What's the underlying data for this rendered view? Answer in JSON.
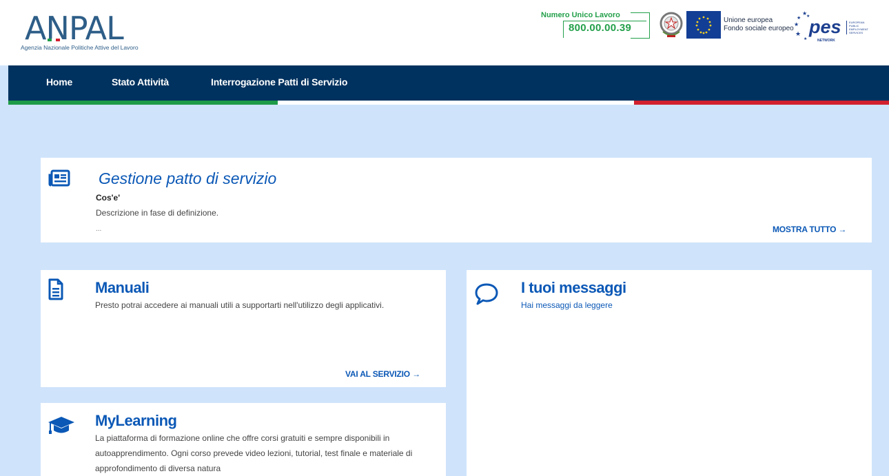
{
  "header": {
    "logo": {
      "name": "ANPAL",
      "subtitle": "Agenzia Nazionale Politiche Attive del Lavoro",
      "colors": {
        "primary": "#2e5e88",
        "flag": [
          "#1e9b48",
          "#ffffff",
          "#d2202f"
        ]
      }
    },
    "numero_unico": {
      "label": "Numero Unico Lavoro",
      "value": "800.00.00.39",
      "color": "#23a04a"
    },
    "eu": {
      "line1": "Unione europea",
      "line2": "Fondo sociale europeo"
    },
    "pes": {
      "word": "pes",
      "network": "NETWORK",
      "side_lines": [
        "EUROPEAN",
        "PUBLIC",
        "EMPLOYMENT",
        "SERVICES"
      ]
    }
  },
  "nav": {
    "items": [
      {
        "label": "Home"
      },
      {
        "label": "Stato Attività"
      },
      {
        "label": "Interrogazione Patti di Servizio"
      }
    ],
    "background": "#00325f"
  },
  "gestione": {
    "icon": "newspaper-icon",
    "title": "Gestione patto di servizio",
    "subheading": "Cos'e'",
    "description": "Descrizione in fase di definizione.",
    "ellipsis": "...",
    "action": "MOSTRA TUTTO"
  },
  "manuali": {
    "icon": "document-icon",
    "title": "Manuali",
    "description": "Presto potrai accedere ai manuali utili a supportarti nell'utilizzo degli applicativi.",
    "action": "VAI AL SERVIZIO"
  },
  "messaggi": {
    "icon": "speech-bubble-icon",
    "title": "I tuoi messaggi",
    "subtitle": "Hai messaggi da leggere"
  },
  "mylearning": {
    "icon": "graduation-cap-icon",
    "title": "MyLearning",
    "description": "La piattaforma di formazione online che offre corsi gratuiti e sempre disponibili in autoapprendimento. Ogni corso prevede video lezioni, tutorial, test finale e materiale di approfondimento di diversa natura"
  },
  "colors": {
    "accent": "#0b58b6",
    "page_bg": "#cfe3fb"
  }
}
